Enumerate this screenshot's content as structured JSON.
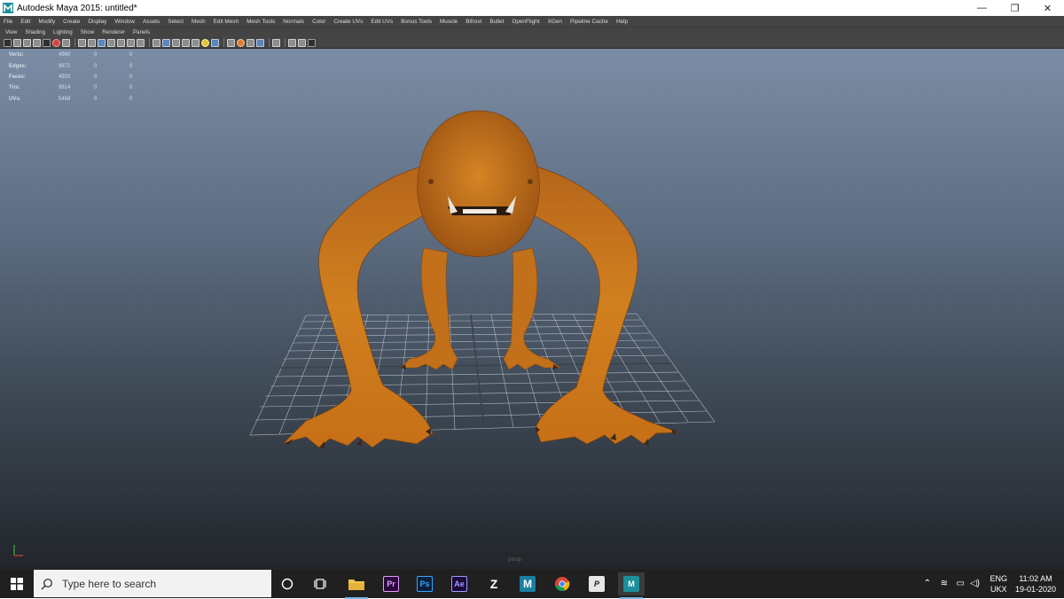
{
  "window": {
    "title": "Autodesk Maya 2015: untitled*",
    "controls": {
      "minimize": "—",
      "maximize": "❐",
      "close": "✕"
    }
  },
  "menubar": [
    "File",
    "Edit",
    "Modify",
    "Create",
    "Display",
    "Window",
    "Assets",
    "Select",
    "Mesh",
    "Edit Mesh",
    "Mesh Tools",
    "Normals",
    "Color",
    "Create UVs",
    "Edit UVs",
    "Bonus Tools",
    "Muscle",
    "Bifrost",
    "Bullet",
    "OpenFlight",
    "XGen",
    "Pipeline Cache",
    "Help"
  ],
  "panel_menu": [
    "View",
    "Shading",
    "Lighting",
    "Show",
    "Renderer",
    "Panels"
  ],
  "hud": {
    "rows": [
      {
        "label": "Verts:",
        "v1": "4960",
        "v2": "0",
        "v3": "0"
      },
      {
        "label": "Edges:",
        "v1": "9872",
        "v2": "0",
        "v3": "0"
      },
      {
        "label": "Faces:",
        "v1": "4920",
        "v2": "0",
        "v3": "0"
      },
      {
        "label": "Tris:",
        "v1": "9814",
        "v2": "0",
        "v3": "0"
      },
      {
        "label": "UVs:",
        "v1": "5468",
        "v2": "0",
        "v3": "0"
      }
    ]
  },
  "viewport": {
    "camera_label": "persp"
  },
  "taskbar": {
    "search_placeholder": "Type here to search",
    "apps": [
      {
        "name": "cortana",
        "glyph": "○"
      },
      {
        "name": "task-view",
        "glyph": "⧉"
      },
      {
        "name": "file-explorer",
        "glyph": ""
      },
      {
        "name": "premiere",
        "glyph": "Pr"
      },
      {
        "name": "photoshop",
        "glyph": "Ps"
      },
      {
        "name": "after-effects",
        "glyph": "Ae"
      },
      {
        "name": "zbrush",
        "glyph": "Z"
      },
      {
        "name": "mudbox",
        "glyph": "M"
      },
      {
        "name": "chrome",
        "glyph": ""
      },
      {
        "name": "pixologic",
        "glyph": "P"
      },
      {
        "name": "maya",
        "glyph": "M"
      }
    ],
    "tray": {
      "language": "ENG",
      "layout": "UKX",
      "time": "11:02 AM",
      "date": "19-01-2020"
    }
  },
  "colors": {
    "menubar_bg": "#444444",
    "viewport_top": "#7b8da5",
    "viewport_bottom": "#22262b",
    "character": "#c8741a",
    "taskbar_bg": "#202020"
  }
}
